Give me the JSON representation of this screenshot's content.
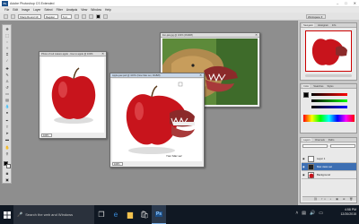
{
  "window": {
    "title": "Adobe Photoshop CS Extended",
    "controls": [
      "–",
      "□",
      "✕"
    ]
  },
  "menu": [
    "File",
    "Edit",
    "Image",
    "Layer",
    "Select",
    "Filter",
    "Analysis",
    "View",
    "Window",
    "Help"
  ],
  "options_bar": {
    "brush_field": "Sharp Round 19",
    "mode_label": "Regular",
    "size_field": "6 pt",
    "workspace_label": "Workspace ▾"
  },
  "documents": [
    {
      "title": "Photo of red mature apple - Use to apple @ 100%",
      "zoom": "100%",
      "subject": "apple"
    },
    {
      "title": "lion-jaw.jpg @ 100% (RGB/8)",
      "zoom": "100%",
      "subject": "lion"
    },
    {
      "title": "Apple-jaw.psd @ 100% (New Mac set, RGB/8)",
      "zoom": "100%",
      "subject": "apple-jaw",
      "caption": "Your Mac set"
    }
  ],
  "panels": {
    "navigator_tabs": [
      "Navigator",
      "Histogram",
      "Info"
    ],
    "color_tabs": [
      "Color",
      "Swatches",
      "Styles"
    ],
    "layers_tabs": [
      "Layers",
      "Channels",
      "Paths"
    ],
    "layers": [
      {
        "name": "Layer 1",
        "selected": false
      },
      {
        "name": "Mac Jaws set",
        "selected": true
      },
      {
        "name": "Background",
        "selected": false
      }
    ]
  },
  "taskbar": {
    "search_placeholder": "Search the web and Windows",
    "time": "4:58 PM",
    "date": "12/20/2015"
  },
  "colors": {
    "workspace": "#8e8e8e",
    "apple_red": "#c8141c",
    "taskbar": "#101823",
    "selection": "#3d6fb3"
  }
}
